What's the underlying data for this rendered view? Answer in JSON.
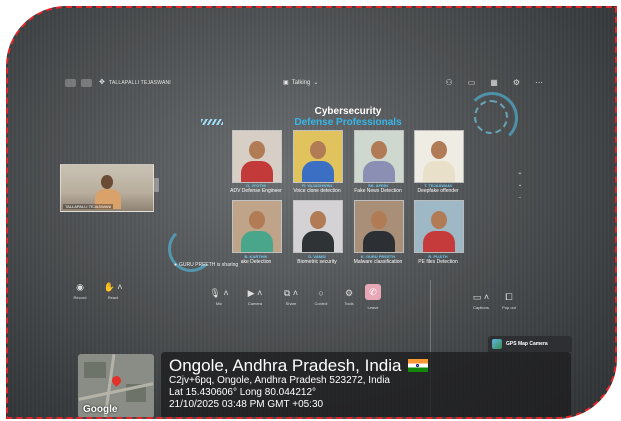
{
  "meeting": {
    "presenter_name": "TALLAPALLI TEJASWANI",
    "status_label": "Talking",
    "sharing_text": "GURU PREETH is sharing"
  },
  "slide": {
    "title_line1": "Cybersecurity",
    "title_line2": "Defense Professionals",
    "participants": [
      {
        "name": "D. JYOTHI",
        "role": "ADV Defense Engineer",
        "bg": "#d7cfc5",
        "shirt": "#c23a3a"
      },
      {
        "name": "R. YAJASHWINI",
        "role": "Voice clone detection",
        "bg": "#e0c35c",
        "shirt": "#3a6fc4"
      },
      {
        "name": "SK. AFRIN",
        "role": "Fake News Detection",
        "bg": "#cfd8cf",
        "shirt": "#8a8fb3"
      },
      {
        "name": "T. TEJASWANI",
        "role": "Deepfake offender",
        "bg": "#efece4",
        "shirt": "#e9e0c9"
      },
      {
        "name": "B. KARTHIK",
        "role": "ake Detection",
        "bg": "#bfa48a",
        "shirt": "#4aa68a"
      },
      {
        "name": "D. VAMSI",
        "role": "Biometric security",
        "bg": "#d4d2d4",
        "shirt": "#2f3336"
      },
      {
        "name": "K. GURU PREETH",
        "role": "Malware classification",
        "bg": "#a98f78",
        "shirt": "#2c2f33"
      },
      {
        "name": "R. PUJITH",
        "role": "PE files Detection",
        "bg": "#9fb8c6",
        "shirt": "#c53a3a"
      }
    ]
  },
  "self_view": {
    "name": "TALLAPALLI TEJASWANI"
  },
  "toolbar": {
    "record": "Record",
    "react": "React",
    "mic": "Mic",
    "camera": "Camera",
    "share": "Share",
    "control": "Control",
    "tools": "Tools",
    "leave": "Leave",
    "captions": "Captions",
    "popout": "Pop out"
  },
  "geotag": {
    "app_label": "GPS Map Camera",
    "city": "Ongole, Andhra Pradesh, India",
    "address": "C2jv+6pq, Ongole, Andhra Pradesh 523272, India",
    "coords": "Lat 15.430606° Long 80.044212°",
    "datetime": "21/10/2025 03:48 PM GMT +05:30",
    "map_logo": "Google"
  },
  "colors": {
    "accent_cyan": "#37b6e8",
    "leave_button": "#e8a7b7",
    "frame_border": "#e0262b"
  }
}
